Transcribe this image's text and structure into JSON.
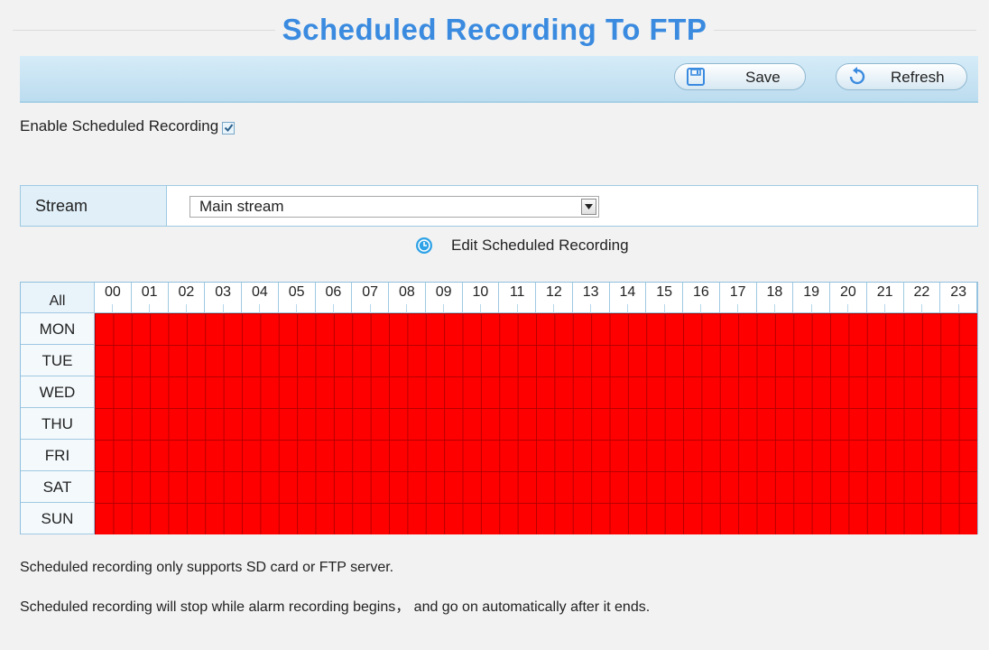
{
  "page": {
    "title": "Scheduled Recording To FTP"
  },
  "toolbar": {
    "save_label": "Save",
    "refresh_label": "Refresh"
  },
  "enable": {
    "label": "Enable Scheduled Recording",
    "checked": true
  },
  "stream": {
    "label": "Stream",
    "selected": "Main stream"
  },
  "edit": {
    "label": "Edit Scheduled Recording"
  },
  "schedule": {
    "all_label": "All",
    "hours": [
      "00",
      "01",
      "02",
      "03",
      "04",
      "05",
      "06",
      "07",
      "08",
      "09",
      "10",
      "11",
      "12",
      "13",
      "14",
      "15",
      "16",
      "17",
      "18",
      "19",
      "20",
      "21",
      "22",
      "23"
    ],
    "days": [
      "MON",
      "TUE",
      "WED",
      "THU",
      "FRI",
      "SAT",
      "SUN"
    ],
    "selected_color": "#ff0000",
    "all_slots_selected": true
  },
  "notes": {
    "line1": "Scheduled recording only supports SD card or FTP server.",
    "line2": "Scheduled recording will stop while alarm recording begins， and go on automatically after it ends."
  },
  "colors": {
    "title": "#3a8be0",
    "toolbar": "#c6e3f3",
    "recording": "#ff0000"
  }
}
